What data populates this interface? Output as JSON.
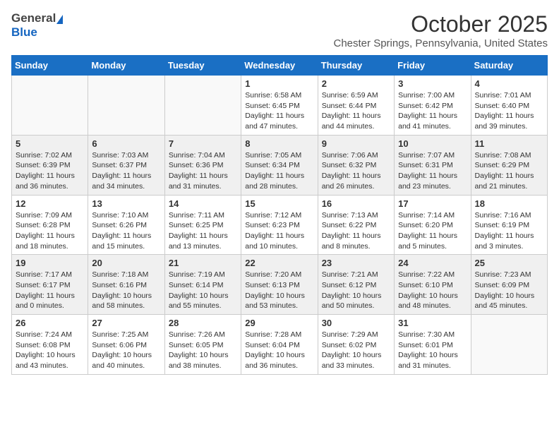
{
  "header": {
    "logo_general": "General",
    "logo_blue": "Blue",
    "month": "October 2025",
    "location": "Chester Springs, Pennsylvania, United States"
  },
  "days_of_week": [
    "Sunday",
    "Monday",
    "Tuesday",
    "Wednesday",
    "Thursday",
    "Friday",
    "Saturday"
  ],
  "weeks": [
    [
      {
        "day": "",
        "info": ""
      },
      {
        "day": "",
        "info": ""
      },
      {
        "day": "",
        "info": ""
      },
      {
        "day": "1",
        "info": "Sunrise: 6:58 AM\nSunset: 6:45 PM\nDaylight: 11 hours\nand 47 minutes."
      },
      {
        "day": "2",
        "info": "Sunrise: 6:59 AM\nSunset: 6:44 PM\nDaylight: 11 hours\nand 44 minutes."
      },
      {
        "day": "3",
        "info": "Sunrise: 7:00 AM\nSunset: 6:42 PM\nDaylight: 11 hours\nand 41 minutes."
      },
      {
        "day": "4",
        "info": "Sunrise: 7:01 AM\nSunset: 6:40 PM\nDaylight: 11 hours\nand 39 minutes."
      }
    ],
    [
      {
        "day": "5",
        "info": "Sunrise: 7:02 AM\nSunset: 6:39 PM\nDaylight: 11 hours\nand 36 minutes."
      },
      {
        "day": "6",
        "info": "Sunrise: 7:03 AM\nSunset: 6:37 PM\nDaylight: 11 hours\nand 34 minutes."
      },
      {
        "day": "7",
        "info": "Sunrise: 7:04 AM\nSunset: 6:36 PM\nDaylight: 11 hours\nand 31 minutes."
      },
      {
        "day": "8",
        "info": "Sunrise: 7:05 AM\nSunset: 6:34 PM\nDaylight: 11 hours\nand 28 minutes."
      },
      {
        "day": "9",
        "info": "Sunrise: 7:06 AM\nSunset: 6:32 PM\nDaylight: 11 hours\nand 26 minutes."
      },
      {
        "day": "10",
        "info": "Sunrise: 7:07 AM\nSunset: 6:31 PM\nDaylight: 11 hours\nand 23 minutes."
      },
      {
        "day": "11",
        "info": "Sunrise: 7:08 AM\nSunset: 6:29 PM\nDaylight: 11 hours\nand 21 minutes."
      }
    ],
    [
      {
        "day": "12",
        "info": "Sunrise: 7:09 AM\nSunset: 6:28 PM\nDaylight: 11 hours\nand 18 minutes."
      },
      {
        "day": "13",
        "info": "Sunrise: 7:10 AM\nSunset: 6:26 PM\nDaylight: 11 hours\nand 15 minutes."
      },
      {
        "day": "14",
        "info": "Sunrise: 7:11 AM\nSunset: 6:25 PM\nDaylight: 11 hours\nand 13 minutes."
      },
      {
        "day": "15",
        "info": "Sunrise: 7:12 AM\nSunset: 6:23 PM\nDaylight: 11 hours\nand 10 minutes."
      },
      {
        "day": "16",
        "info": "Sunrise: 7:13 AM\nSunset: 6:22 PM\nDaylight: 11 hours\nand 8 minutes."
      },
      {
        "day": "17",
        "info": "Sunrise: 7:14 AM\nSunset: 6:20 PM\nDaylight: 11 hours\nand 5 minutes."
      },
      {
        "day": "18",
        "info": "Sunrise: 7:16 AM\nSunset: 6:19 PM\nDaylight: 11 hours\nand 3 minutes."
      }
    ],
    [
      {
        "day": "19",
        "info": "Sunrise: 7:17 AM\nSunset: 6:17 PM\nDaylight: 11 hours\nand 0 minutes."
      },
      {
        "day": "20",
        "info": "Sunrise: 7:18 AM\nSunset: 6:16 PM\nDaylight: 10 hours\nand 58 minutes."
      },
      {
        "day": "21",
        "info": "Sunrise: 7:19 AM\nSunset: 6:14 PM\nDaylight: 10 hours\nand 55 minutes."
      },
      {
        "day": "22",
        "info": "Sunrise: 7:20 AM\nSunset: 6:13 PM\nDaylight: 10 hours\nand 53 minutes."
      },
      {
        "day": "23",
        "info": "Sunrise: 7:21 AM\nSunset: 6:12 PM\nDaylight: 10 hours\nand 50 minutes."
      },
      {
        "day": "24",
        "info": "Sunrise: 7:22 AM\nSunset: 6:10 PM\nDaylight: 10 hours\nand 48 minutes."
      },
      {
        "day": "25",
        "info": "Sunrise: 7:23 AM\nSunset: 6:09 PM\nDaylight: 10 hours\nand 45 minutes."
      }
    ],
    [
      {
        "day": "26",
        "info": "Sunrise: 7:24 AM\nSunset: 6:08 PM\nDaylight: 10 hours\nand 43 minutes."
      },
      {
        "day": "27",
        "info": "Sunrise: 7:25 AM\nSunset: 6:06 PM\nDaylight: 10 hours\nand 40 minutes."
      },
      {
        "day": "28",
        "info": "Sunrise: 7:26 AM\nSunset: 6:05 PM\nDaylight: 10 hours\nand 38 minutes."
      },
      {
        "day": "29",
        "info": "Sunrise: 7:28 AM\nSunset: 6:04 PM\nDaylight: 10 hours\nand 36 minutes."
      },
      {
        "day": "30",
        "info": "Sunrise: 7:29 AM\nSunset: 6:02 PM\nDaylight: 10 hours\nand 33 minutes."
      },
      {
        "day": "31",
        "info": "Sunrise: 7:30 AM\nSunset: 6:01 PM\nDaylight: 10 hours\nand 31 minutes."
      },
      {
        "day": "",
        "info": ""
      }
    ]
  ]
}
